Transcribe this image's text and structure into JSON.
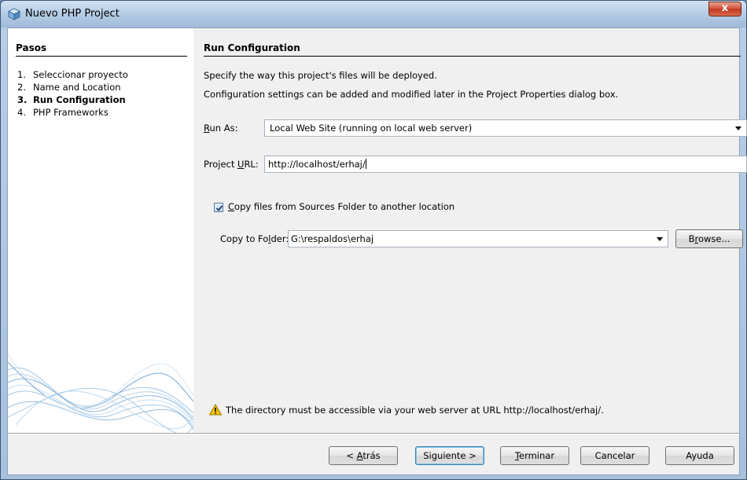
{
  "window": {
    "title": "Nuevo  PHP Project",
    "close_label": "x"
  },
  "steps": {
    "title": "Pasos",
    "items": [
      {
        "num": "1.",
        "label": "Seleccionar proyecto"
      },
      {
        "num": "2.",
        "label": "Name and Location"
      },
      {
        "num": "3.",
        "label": "Run Configuration"
      },
      {
        "num": "4.",
        "label": "PHP Frameworks"
      }
    ]
  },
  "content": {
    "title": "Run Configuration",
    "desc1": "Specify the way this project's files will be deployed.",
    "desc2": "Configuration settings can be added and modified later in the Project Properties dialog box.",
    "run_as": {
      "label_pre": "R",
      "label_post": "un As:",
      "value": "Local Web Site (running on local web server)"
    },
    "project_url": {
      "label_pre": "Project ",
      "label_u": "U",
      "label_post": "RL:",
      "value": "http://localhost/erhaj/"
    },
    "copy_files": {
      "label_u": "C",
      "label_post": "opy files from Sources Folder to another location",
      "checked": true
    },
    "copy_to": {
      "label_pre": "Copy to Fo",
      "label_u": "l",
      "label_post": "der:",
      "value": "G:\\respaldos\\erhaj"
    },
    "browse": {
      "pre": "B",
      "u": "r",
      "post": "owse..."
    },
    "warning": "The directory must be accessible via your web server at URL http://localhost/erhaj/."
  },
  "buttons": {
    "back": {
      "pre": "< ",
      "u": "A",
      "post": "trás"
    },
    "next": "Siguiente >",
    "finish": {
      "u": "T",
      "post": "erminar"
    },
    "cancel": "Cancelar",
    "help": "Ayuda"
  },
  "colors": {
    "accent": "#3c7fb1",
    "warning": "#f5c400"
  }
}
